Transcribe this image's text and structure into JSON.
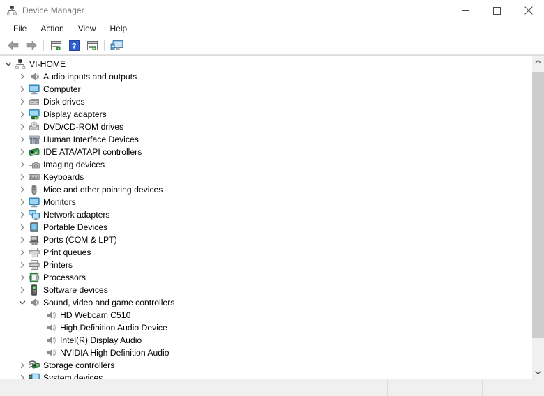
{
  "window": {
    "title": "Device Manager",
    "icon": "device-manager-icon",
    "caption_buttons": [
      {
        "name": "minimize-button",
        "glyph": "minimize"
      },
      {
        "name": "maximize-button",
        "glyph": "maximize"
      },
      {
        "name": "close-button",
        "glyph": "close"
      }
    ]
  },
  "menubar": {
    "items": [
      {
        "label": "File",
        "name": "menu-file"
      },
      {
        "label": "Action",
        "name": "menu-action"
      },
      {
        "label": "View",
        "name": "menu-view"
      },
      {
        "label": "Help",
        "name": "menu-help"
      }
    ]
  },
  "toolbar": {
    "buttons": [
      {
        "name": "back-button",
        "icon": "back-arrow-icon"
      },
      {
        "name": "forward-button",
        "icon": "forward-arrow-icon"
      },
      {
        "name": "separator-1",
        "icon": "separator"
      },
      {
        "name": "properties-button",
        "icon": "properties-window-icon"
      },
      {
        "name": "help-button",
        "icon": "help-question-icon"
      },
      {
        "name": "show-hidden-button",
        "icon": "window-list-icon"
      },
      {
        "name": "separator-2",
        "icon": "separator"
      },
      {
        "name": "scan-hardware-button",
        "icon": "monitor-scan-icon"
      }
    ]
  },
  "tree": {
    "nodes": [
      {
        "label": "VI-HOME",
        "depth": 0,
        "state": "expanded",
        "icon": "computer-network-icon"
      },
      {
        "label": "Audio inputs and outputs",
        "depth": 1,
        "state": "collapsed",
        "icon": "speaker-icon"
      },
      {
        "label": "Computer",
        "depth": 1,
        "state": "collapsed",
        "icon": "monitor-icon"
      },
      {
        "label": "Disk drives",
        "depth": 1,
        "state": "collapsed",
        "icon": "disk-drive-icon"
      },
      {
        "label": "Display adapters",
        "depth": 1,
        "state": "collapsed",
        "icon": "display-adapter-icon"
      },
      {
        "label": "DVD/CD-ROM drives",
        "depth": 1,
        "state": "collapsed",
        "icon": "dvd-drive-icon"
      },
      {
        "label": "Human Interface Devices",
        "depth": 1,
        "state": "collapsed",
        "icon": "hid-icon"
      },
      {
        "label": "IDE ATA/ATAPI controllers",
        "depth": 1,
        "state": "collapsed",
        "icon": "ide-controller-icon"
      },
      {
        "label": "Imaging devices",
        "depth": 1,
        "state": "collapsed",
        "icon": "camera-icon"
      },
      {
        "label": "Keyboards",
        "depth": 1,
        "state": "collapsed",
        "icon": "keyboard-icon"
      },
      {
        "label": "Mice and other pointing devices",
        "depth": 1,
        "state": "collapsed",
        "icon": "mouse-icon"
      },
      {
        "label": "Monitors",
        "depth": 1,
        "state": "collapsed",
        "icon": "monitor-icon"
      },
      {
        "label": "Network adapters",
        "depth": 1,
        "state": "collapsed",
        "icon": "network-adapter-icon"
      },
      {
        "label": "Portable Devices",
        "depth": 1,
        "state": "collapsed",
        "icon": "portable-device-icon"
      },
      {
        "label": "Ports (COM & LPT)",
        "depth": 1,
        "state": "collapsed",
        "icon": "port-icon"
      },
      {
        "label": "Print queues",
        "depth": 1,
        "state": "collapsed",
        "icon": "printer-icon"
      },
      {
        "label": "Printers",
        "depth": 1,
        "state": "collapsed",
        "icon": "printer-icon"
      },
      {
        "label": "Processors",
        "depth": 1,
        "state": "collapsed",
        "icon": "processor-icon"
      },
      {
        "label": "Software devices",
        "depth": 1,
        "state": "collapsed",
        "icon": "software-device-icon"
      },
      {
        "label": "Sound, video and game controllers",
        "depth": 1,
        "state": "expanded",
        "icon": "speaker-icon"
      },
      {
        "label": "HD Webcam C510",
        "depth": 2,
        "state": "leaf",
        "icon": "speaker-icon"
      },
      {
        "label": "High Definition Audio Device",
        "depth": 2,
        "state": "leaf",
        "icon": "speaker-icon"
      },
      {
        "label": "Intel(R) Display Audio",
        "depth": 2,
        "state": "leaf",
        "icon": "speaker-icon"
      },
      {
        "label": "NVIDIA High Definition Audio",
        "depth": 2,
        "state": "leaf",
        "icon": "speaker-icon"
      },
      {
        "label": "Storage controllers",
        "depth": 1,
        "state": "collapsed",
        "icon": "storage-controller-icon"
      },
      {
        "label": "System devices",
        "depth": 1,
        "state": "collapsed",
        "icon": "system-device-icon"
      }
    ]
  },
  "scrollbar": {
    "up_arrow": "scroll-up-icon",
    "down_arrow": "scroll-down-icon"
  },
  "statusbar": {
    "panes": [
      "",
      "",
      "",
      ""
    ]
  },
  "colors": {
    "title_text": "#767676",
    "window_bg": "#ffffff",
    "statusbar_bg": "#f0f0f0",
    "scroll_thumb": "#cdcdcd",
    "accent_blue": "#3a9fd8",
    "accent_green": "#3f9b3f"
  }
}
